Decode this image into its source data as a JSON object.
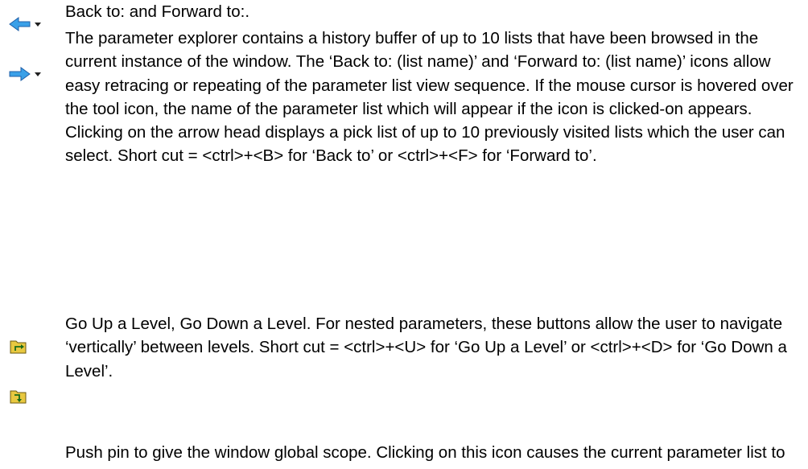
{
  "entries": [
    {
      "icons": [
        "back-arrow-dropdown-icon",
        "forward-arrow-dropdown-icon"
      ],
      "title": "Back to: and Forward to:.",
      "body": "The parameter explorer contains a history buffer of up to 10 lists that have been browsed in the current instance of the window. The ‘Back to: (list name)’ and ‘Forward to: (list name)’ icons allow easy retracing or repeating of the parameter list view sequence. If the mouse cursor is hovered over the tool icon, the name of the parameter list which will appear if the icon is clicked-on appears. Clicking on the arrow head displays a pick list of up to 10 previously visited lists which the user can select. Short cut = <ctrl>+<B> for ‘Back to’ or <ctrl>+<F> for ‘Forward to’."
    },
    {
      "icons": [
        "folder-up-icon",
        "folder-down-icon"
      ],
      "body": "Go Up a Level, Go Down a Level. For nested parameters, these buttons allow the user to navigate ‘vertically’ between levels. Short cut = <ctrl>+<U> for ‘Go Up a Level’ or <ctrl>+<D> for ‘Go Down a Level’."
    },
    {
      "icons": [
        "push-pin-horizontal-icon",
        "push-pin-pressed-icon"
      ],
      "body": "Push pin to give the window global scope. Clicking on this icon causes the current parameter list to be permanently displayed, even if another instrument becomes the ‘current device’."
    }
  ],
  "colors": {
    "arrow_fill": "#3aa0e8",
    "arrow_stroke": "#1f5fa8",
    "folder_fill": "#e8c840",
    "folder_stroke": "#6b5a10",
    "folder_arrow": "#1a6a1a",
    "pin_color": "#404040"
  }
}
